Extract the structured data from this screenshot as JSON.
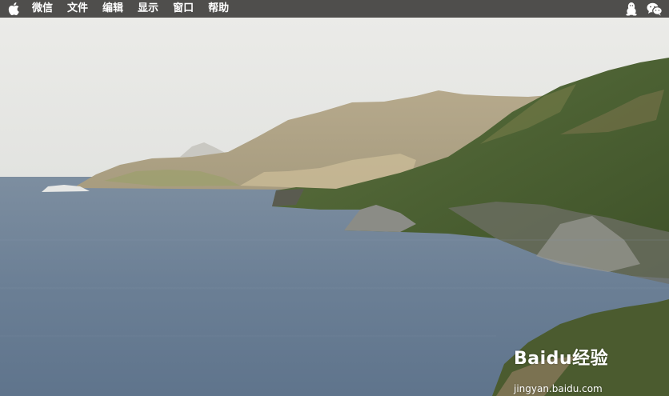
{
  "menubar": {
    "background": "#4f4e4c",
    "items": [
      {
        "label": "微信"
      },
      {
        "label": "文件"
      },
      {
        "label": "编辑"
      },
      {
        "label": "显示"
      },
      {
        "label": "窗口"
      },
      {
        "label": "帮助"
      }
    ],
    "status_icons": [
      "qq-penguin-icon",
      "wechat-icon"
    ]
  },
  "desktop": {
    "wallpaper": "coastal landscape with green hills and sea",
    "watermark": {
      "brand": "Baidu经验",
      "url": "jingyan.baidu.com"
    }
  }
}
